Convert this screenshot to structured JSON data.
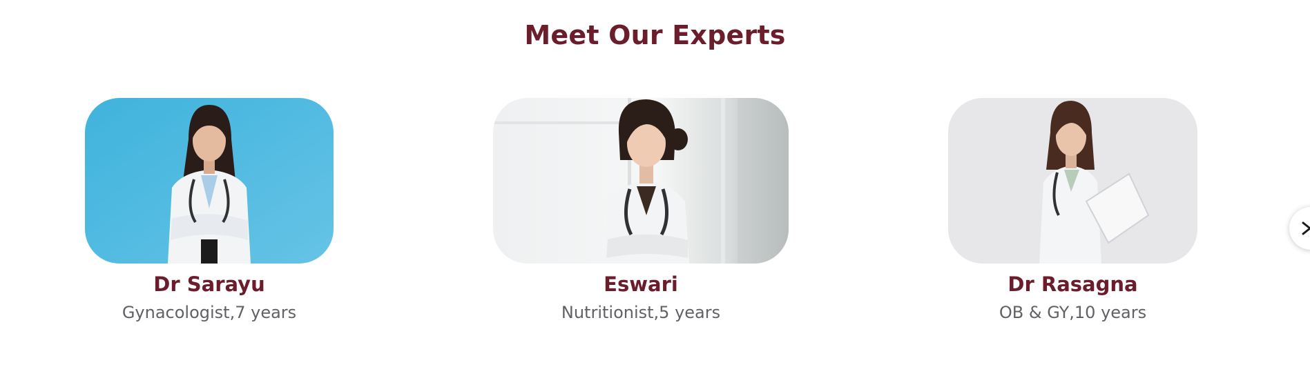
{
  "section": {
    "title": "Meet Our Experts"
  },
  "experts": [
    {
      "name": "Dr Sarayu",
      "role": "Gynacologist,7 years"
    },
    {
      "name": "Eswari",
      "role": "Nutritionist,5 years"
    },
    {
      "name": "Dr Rasagna",
      "role": "OB & GY,10 years"
    }
  ],
  "carousel": {
    "next_icon": "chevron-right-icon"
  },
  "colors": {
    "accent": "#6b1d2b",
    "muted_text": "#5f6164",
    "background": "#ffffff"
  }
}
